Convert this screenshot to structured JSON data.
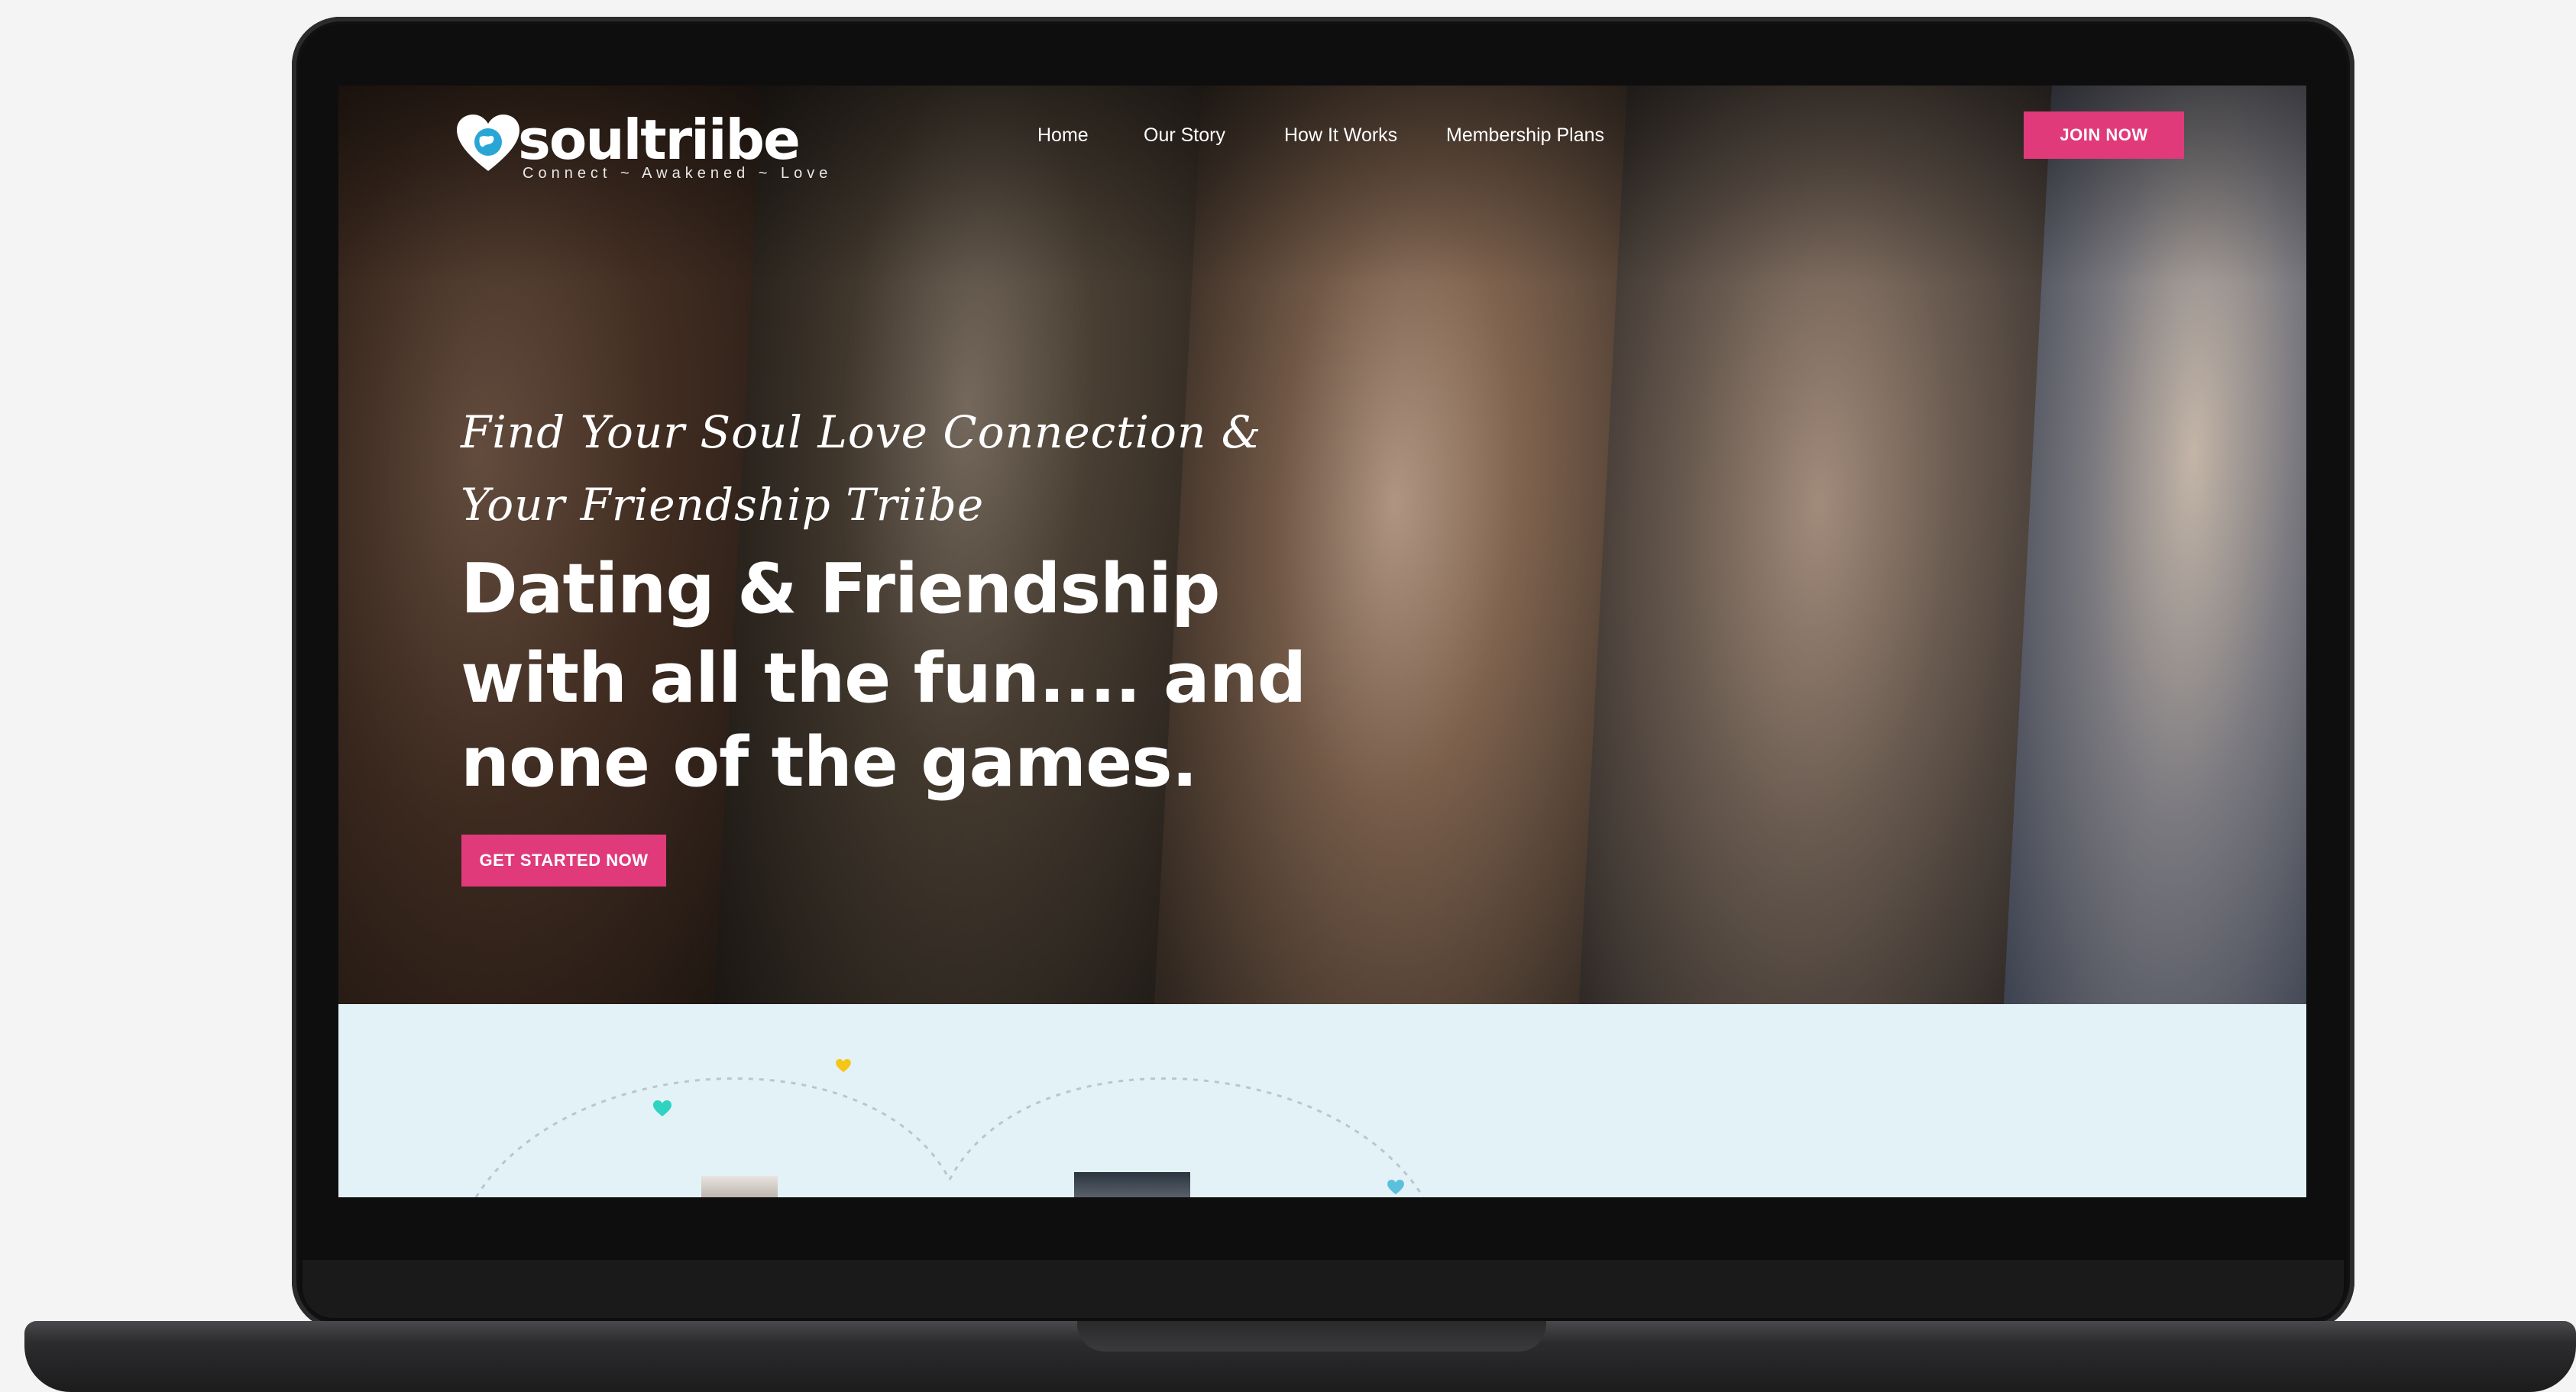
{
  "brand": {
    "name": "soultriibe",
    "tagline": "Connect ~ Awakened ~ Love"
  },
  "nav": {
    "items": [
      {
        "label": "Home"
      },
      {
        "label": "Our Story"
      },
      {
        "label": "How It Works"
      },
      {
        "label": "Membership Plans"
      }
    ],
    "join_label": "JOIN NOW"
  },
  "hero": {
    "script_line_1": "Find Your Soul Love Connection &",
    "script_line_2": "Your Friendship Triibe",
    "headline_1": "Dating & Friendship",
    "headline_2": "with all the fun.... and",
    "headline_3": "none of the games.",
    "cta_label": "GET STARTED NOW"
  },
  "colors": {
    "accent": "#e03a7a",
    "lower_bg": "#e2f2f7",
    "heart_teal": "#2fd3c0",
    "heart_yellow": "#f5c518",
    "heart_blue": "#5bc0de"
  }
}
